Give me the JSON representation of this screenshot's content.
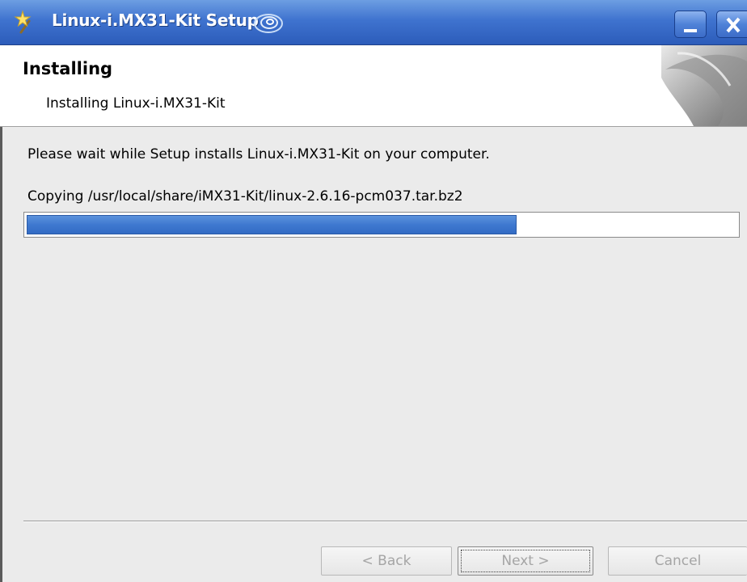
{
  "window": {
    "title": "Linux-i.MX31-Kit Setup",
    "icons": {
      "app": "wizard-wand-icon",
      "swirl": "swirl-icon",
      "minimize": "minimize-icon",
      "close": "close-icon"
    }
  },
  "header": {
    "title": "Installing",
    "subtitle": "Installing Linux-i.MX31-Kit"
  },
  "body": {
    "wait_text": "Please wait while Setup installs Linux-i.MX31-Kit on your computer.",
    "status_text": "Copying /usr/local/share/iMX31-Kit/linux-2.6.16-pcm037.tar.bz2",
    "progress_fraction": 0.69
  },
  "buttons": {
    "back": "< Back",
    "next": "Next >",
    "cancel": "Cancel"
  },
  "colors": {
    "titlebar": "#3f73cf",
    "progress": "#3f79d0"
  }
}
